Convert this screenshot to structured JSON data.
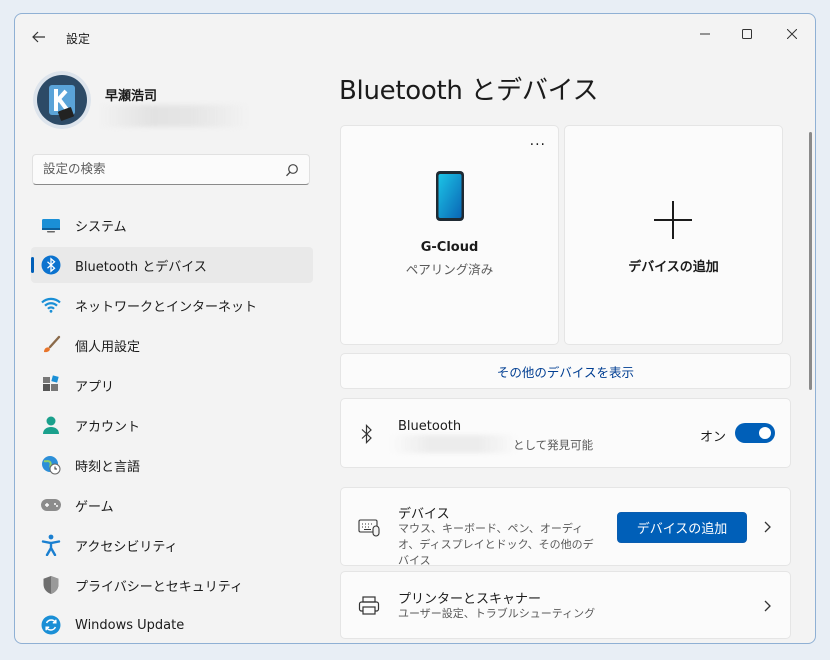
{
  "window": {
    "title": "設定",
    "accent": "#005fb8"
  },
  "user": {
    "name": "早瀬浩司"
  },
  "search": {
    "placeholder": "設定の検索"
  },
  "nav": {
    "items": [
      {
        "label": "システム",
        "icon": "system-icon"
      },
      {
        "label": "Bluetooth とデバイス",
        "icon": "bluetooth-icon",
        "selected": true
      },
      {
        "label": "ネットワークとインターネット",
        "icon": "wifi-icon"
      },
      {
        "label": "個人用設定",
        "icon": "paintbrush-icon"
      },
      {
        "label": "アプリ",
        "icon": "apps-icon"
      },
      {
        "label": "アカウント",
        "icon": "account-icon"
      },
      {
        "label": "時刻と言語",
        "icon": "globe-clock-icon"
      },
      {
        "label": "ゲーム",
        "icon": "gamepad-icon"
      },
      {
        "label": "アクセシビリティ",
        "icon": "accessibility-icon"
      },
      {
        "label": "プライバシーとセキュリティ",
        "icon": "shield-icon"
      },
      {
        "label": "Windows Update",
        "icon": "update-icon"
      }
    ]
  },
  "main": {
    "title": "Bluetooth とデバイス",
    "device_card": {
      "more": "···",
      "name": "G-Cloud",
      "status": "ペアリング済み"
    },
    "add_card": {
      "label": "デバイスの追加"
    },
    "more_devices_link": "その他のデバイスを表示",
    "bluetooth": {
      "title": "Bluetooth",
      "discoverable": "として発見可能",
      "toggle_label": "オン",
      "enabled": true
    },
    "devices": {
      "title": "デバイス",
      "subtitle": "マウス、キーボード、ペン、オーディオ、ディスプレイとドック、その他のデバイス",
      "button": "デバイスの追加"
    },
    "printers": {
      "title": "プリンターとスキャナー",
      "subtitle": "ユーザー設定、トラブルシューティング"
    }
  }
}
